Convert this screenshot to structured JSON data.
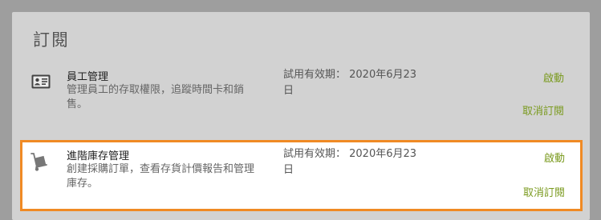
{
  "section": {
    "title": "訂閱"
  },
  "subscriptions": [
    {
      "name": "員工管理",
      "description": "管理員工的存取權限，追蹤時間卡和銷售。",
      "trial": "試用有效期： 2020年6月23日",
      "launch_label": "啟動",
      "cancel_label": "取消訂閱",
      "icon": "id-card-icon"
    },
    {
      "name": "進階庫存管理",
      "description": "創建採購訂單，查看存貨計價報告和管理庫存。",
      "trial": "試用有效期： 2020年6月23日",
      "launch_label": "啟動",
      "cancel_label": "取消訂閱",
      "icon": "hand-truck-icon"
    }
  ],
  "colors": {
    "accent": "#7a9a1e",
    "highlight": "#f08a24",
    "panel": "#d2d2d2",
    "backdrop": "#9e9e9e"
  }
}
